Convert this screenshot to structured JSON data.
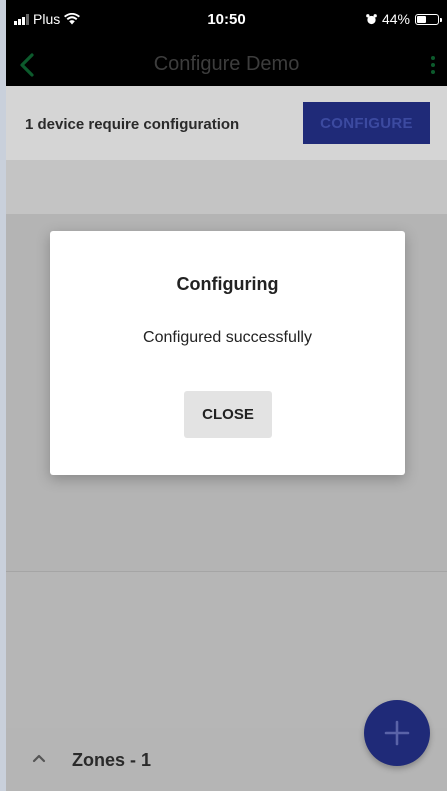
{
  "status_bar": {
    "carrier": "Plus",
    "time": "10:50",
    "battery": "44%"
  },
  "app_bar": {
    "title": "Configure Demo"
  },
  "config_banner": {
    "message": "1 device require configuration",
    "button_label": "CONFIGURE"
  },
  "dialog": {
    "title": "Configuring",
    "message": "Configured successfully",
    "close_label": "CLOSE"
  },
  "zones_bar": {
    "label": "Zones - 1"
  },
  "colors": {
    "accent_green": "#0c5a2c",
    "primary_blue": "#1f2a78",
    "overlay_background": "#b5b5b5"
  }
}
